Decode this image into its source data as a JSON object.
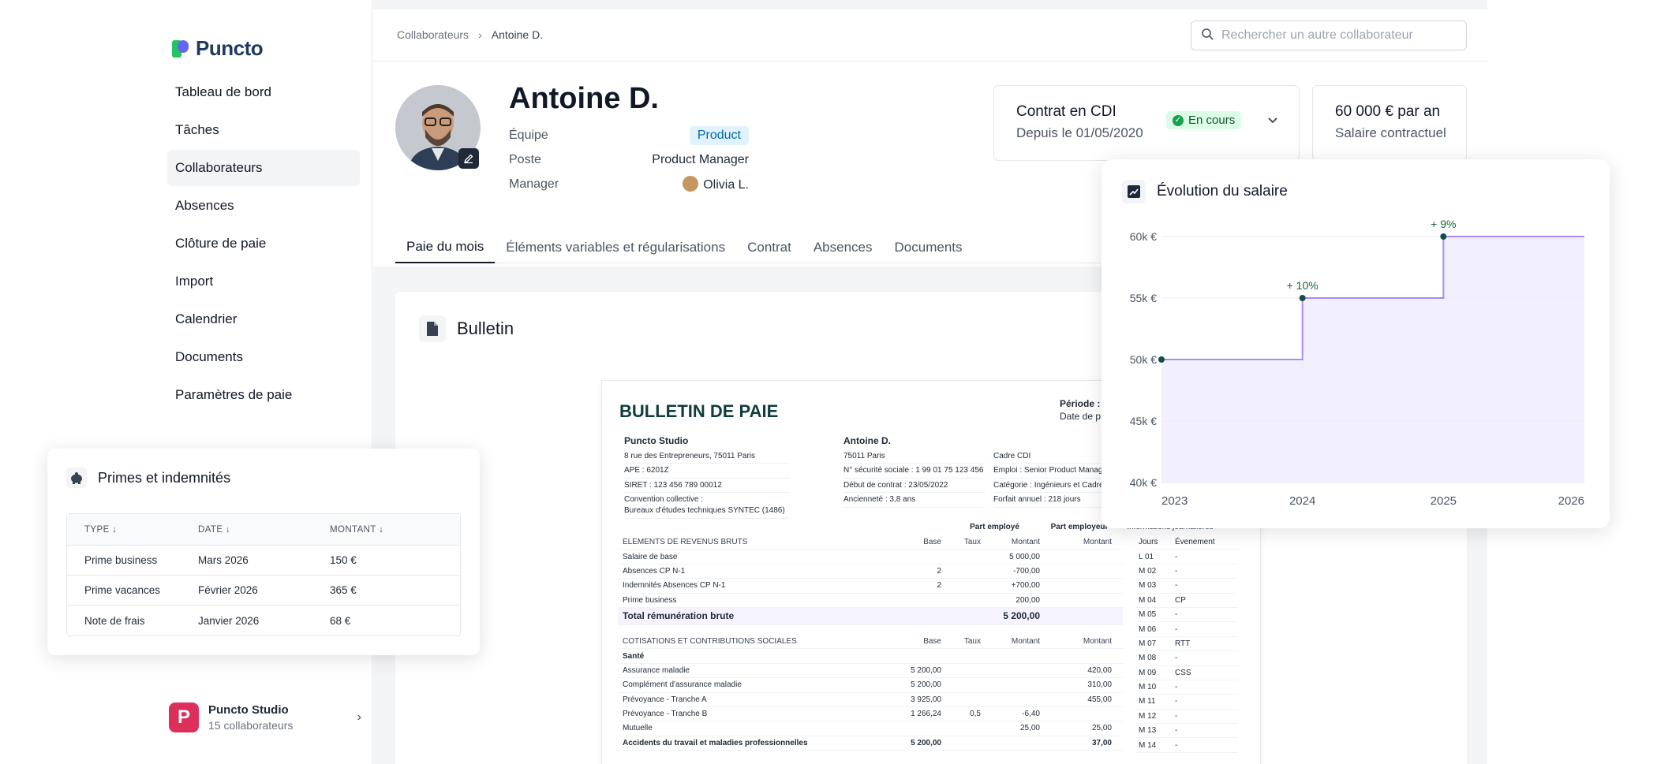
{
  "brand": {
    "name": "Puncto"
  },
  "sidebar": {
    "items": [
      {
        "label": "Tableau de bord"
      },
      {
        "label": "Tâches"
      },
      {
        "label": "Collaborateurs"
      },
      {
        "label": "Absences"
      },
      {
        "label": "Clôture de paie"
      },
      {
        "label": "Import"
      },
      {
        "label": "Calendrier"
      },
      {
        "label": "Documents"
      },
      {
        "label": "Paramètres de paie"
      }
    ],
    "org": {
      "logo": "P",
      "name": "Puncto Studio",
      "count": "15 collaborateurs",
      "chevron": "›"
    }
  },
  "breadcrumb": {
    "root": "Collaborateurs",
    "sep": "›",
    "current": "Antoine D."
  },
  "search": {
    "placeholder": "Rechercher un autre collaborateur"
  },
  "employee": {
    "name": "Antoine D.",
    "team_label": "Équipe",
    "team": "Product",
    "position_label": "Poste",
    "position": "Product Manager",
    "manager_label": "Manager",
    "manager": "Olivia L."
  },
  "contract": {
    "title": "Contrat en CDI",
    "since": "Depuis le 01/05/2020",
    "status": "En cours",
    "chevron": "⌄"
  },
  "salary": {
    "amount": "60 000 € par an",
    "label": "Salaire contractuel"
  },
  "tabs": [
    {
      "label": "Paie du mois"
    },
    {
      "label": "Éléments variables et régularisations"
    },
    {
      "label": "Contrat"
    },
    {
      "label": "Absences"
    },
    {
      "label": "Documents"
    }
  ],
  "bulletin": {
    "title": "Bulletin",
    "doc": {
      "title": "BULLETIN DE PAIE",
      "periode": "Période : (",
      "date": "Date de p",
      "employer": {
        "name": "Puncto Studio",
        "lines": [
          "8 rue des Entrepreneurs, 75011 Paris",
          "APE : 6201Z",
          "SIRET : 123 456 789 00012",
          "Convention collective :",
          "Bureaux d'études techniques SYNTEC (1486)"
        ]
      },
      "employee": {
        "name": "Antoine D.",
        "lines": [
          "75011 Paris",
          "N° sécurité sociale : 1 99 01 75 123 456",
          "Début de contrat : 23/05/2022",
          "Ancienneté : 3,8 ans"
        ]
      },
      "contract": {
        "lines": [
          "Cadre CDI",
          "Emploi : Senior Product Manage",
          "Catégorie : Ingénieurs et Cadres",
          "Forfait annuel : 218 jours"
        ]
      },
      "group_headers": {
        "employee": "Part employé",
        "employer": "Part employeur",
        "days": "Informations journalières"
      },
      "rev_header": {
        "label": "ÉLÉMENTS DE REVENUS BRUTS",
        "base": "Base",
        "taux": "Taux",
        "montant": "Montant",
        "montant2": "Montant"
      },
      "rev_rows": [
        {
          "label": "Salaire de base",
          "base": "",
          "taux": "",
          "montant": "5 000,00",
          "emp": ""
        },
        {
          "label": "Absences CP N-1",
          "base": "2",
          "taux": "",
          "montant": "-700,00",
          "emp": ""
        },
        {
          "label": "Indemnités Absences CP N-1",
          "base": "2",
          "taux": "",
          "montant": "+700,00",
          "emp": ""
        },
        {
          "label": "Prime business",
          "base": "",
          "taux": "",
          "montant": "200,00",
          "emp": ""
        }
      ],
      "total": {
        "label": "Total rémunération brute",
        "montant": "5 200,00"
      },
      "cot_header": {
        "label": "COTISATIONS ET CONTRIBUTIONS SOCIALES",
        "base": "Base",
        "taux": "Taux",
        "montant": "Montant",
        "montant2": "Montant"
      },
      "cot_rows": [
        {
          "label": "Santé",
          "base": "",
          "taux": "",
          "montant": "",
          "emp": "",
          "bold": true
        },
        {
          "label": "Assurance maladie",
          "base": "5 200,00",
          "taux": "",
          "montant": "",
          "emp": "420,00"
        },
        {
          "label": "Complément d'assurance maladie",
          "base": "5 200,00",
          "taux": "",
          "montant": "",
          "emp": "310,00"
        },
        {
          "label": "Prévoyance - Tranche A",
          "base": "3 925,00",
          "taux": "",
          "montant": "",
          "emp": "455,00"
        },
        {
          "label": "Prévoyance - Tranche B",
          "base": "1 266,24",
          "taux": "0,5",
          "montant": "-6,40",
          "emp": ""
        },
        {
          "label": "Mutuelle",
          "base": "",
          "taux": "",
          "montant": "25,00",
          "emp": "25,00"
        },
        {
          "label": "Accidents du travail et maladies professionnelles",
          "base": "5 200,00",
          "taux": "",
          "montant": "",
          "emp": "37,00",
          "bold": true
        }
      ],
      "days_header": {
        "jours": "Jours",
        "event": "Évenement"
      },
      "days": [
        {
          "j": "L 01",
          "e": "-"
        },
        {
          "j": "M 02",
          "e": "-"
        },
        {
          "j": "M 03",
          "e": "-"
        },
        {
          "j": "M 04",
          "e": "CP"
        },
        {
          "j": "M 05",
          "e": "-"
        },
        {
          "j": "M 06",
          "e": "-"
        },
        {
          "j": "M 07",
          "e": "RTT"
        },
        {
          "j": "M 08",
          "e": "-"
        },
        {
          "j": "M 09",
          "e": "CSS"
        },
        {
          "j": "M 10",
          "e": "-"
        },
        {
          "j": "M 11",
          "e": "-"
        },
        {
          "j": "M 12",
          "e": "-"
        },
        {
          "j": "M 13",
          "e": "-"
        },
        {
          "j": "M 14",
          "e": "-"
        }
      ]
    }
  },
  "primes": {
    "title": "Primes et indemnités",
    "headers": {
      "type": "TYPE ↓",
      "date": "DATE ↓",
      "montant": "MONTANT ↓"
    },
    "rows": [
      {
        "type": "Prime business",
        "date": "Mars 2026",
        "montant": "150 €"
      },
      {
        "type": "Prime vacances",
        "date": "Février 2026",
        "montant": "365 €"
      },
      {
        "type": "Note de frais",
        "date": "Janvier 2026",
        "montant": "68 €"
      }
    ]
  },
  "chart_data": {
    "type": "area",
    "title": "Évolution du salaire",
    "x": [
      "2023",
      "2024",
      "2025",
      "2026"
    ],
    "series": [
      {
        "values": [
          50000,
          55000,
          60000,
          60000
        ]
      }
    ],
    "step": true,
    "ylim": [
      40000,
      60000
    ],
    "ytick_labels": [
      "60k €",
      "55k €",
      "50k €",
      "45k €",
      "40k €"
    ],
    "yticks": [
      60000,
      55000,
      50000,
      45000,
      40000
    ],
    "annotations": [
      {
        "x": "2024",
        "text": "+ 10%"
      },
      {
        "x": "2025",
        "text": "+ 9%"
      }
    ],
    "grid": true,
    "colors": {
      "line": "#a78bfa",
      "fill": "#ede9fe",
      "point": "#134e4a",
      "annotation": "#166534"
    }
  }
}
